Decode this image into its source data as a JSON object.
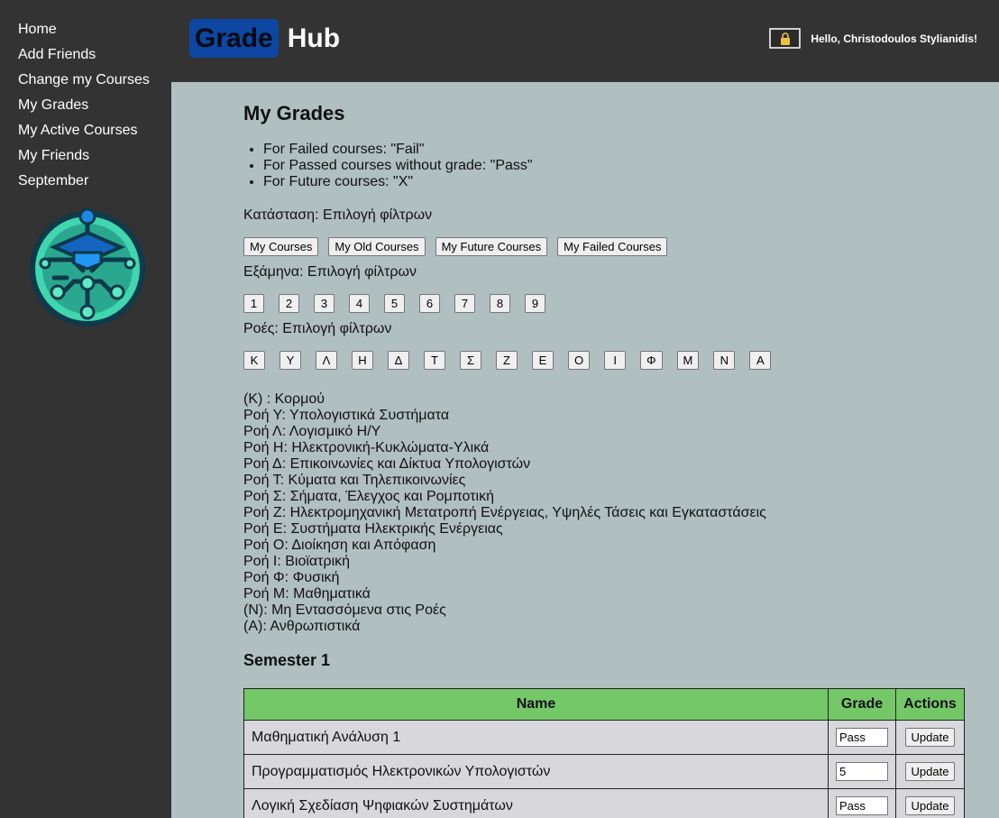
{
  "sidebar": {
    "items": [
      {
        "label": "Home"
      },
      {
        "label": "Add Friends"
      },
      {
        "label": "Change my Courses"
      },
      {
        "label": "My Grades"
      },
      {
        "label": "My Active Courses"
      },
      {
        "label": "My Friends"
      },
      {
        "label": "September"
      }
    ]
  },
  "header": {
    "brand_part1": "Grade",
    "brand_part2": "Hub",
    "greeting": "Hello, Christodoulos Stylianidis!"
  },
  "page": {
    "title": "My Grades",
    "hints": [
      "For Failed courses: \"Fail\"",
      "For Passed courses without grade: \"Pass\"",
      "For Future courses: \"X\""
    ]
  },
  "filters": {
    "status_label": "Κατάσταση: Επιλογή φίλτρων",
    "status_buttons": [
      "My Courses",
      "My Old Courses",
      "My Future Courses",
      "My Failed Courses"
    ],
    "semester_label": "Εξάμηνα: Επιλογή φίλτρων",
    "semester_buttons": [
      "1",
      "2",
      "3",
      "4",
      "5",
      "6",
      "7",
      "8",
      "9"
    ],
    "stream_label": "Ροές: Επιλογή φίλτρων",
    "stream_buttons": [
      "Κ",
      "Υ",
      "Λ",
      "Η",
      "Δ",
      "Τ",
      "Σ",
      "Ζ",
      "Ε",
      "Ο",
      "Ι",
      "Φ",
      "Μ",
      "Ν",
      "Α"
    ]
  },
  "legend": [
    "(Κ) : Κορμού",
    "Ροή Υ: Υπολογιστικά Συστήματα",
    "Ροή Λ: Λογισμικό Η/Υ",
    "Ροή Η: Ηλεκτρονική-Κυκλώματα-Υλικά",
    "Ροή Δ: Επικοινωνίες και Δίκτυα Υπολογιστών",
    "Ροή Τ: Κύματα και Τηλεπικοινωνίες",
    "Ροή Σ: Σήματα, Έλεγχος και Ρομποτική",
    "Ροή Ζ: Ηλεκτρομηχανική Μετατροπή Ενέργειας, Υψηλές Τάσεις και Εγκαταστάσεις",
    "Ροή Ε: Συστήματα Ηλεκτρικής Ενέργειας",
    "Ροή Ο: Διοίκηση και Απόφαση",
    "Ροή Ι: Βιοϊατρική",
    "Ροή Φ: Φυσική",
    "Ροή Μ: Μαθηματικά",
    "(Ν): Μη Εντασσόμενα στις Ροές",
    "(Α): Ανθρωπιστικά"
  ],
  "semester": {
    "title": "Semester 1",
    "columns": [
      "Name",
      "Grade",
      "Actions"
    ],
    "rows": [
      {
        "name": "Μαθηματική Ανάλυση 1",
        "grade": "Pass",
        "action": "Update"
      },
      {
        "name": "Προγραμματισμός Ηλεκτρονικών Υπολογιστών",
        "grade": "5",
        "action": "Update"
      },
      {
        "name": "Λογική Σχεδίαση Ψηφιακών Συστημάτων",
        "grade": "Pass",
        "action": "Update"
      }
    ]
  },
  "colors": {
    "sidebar_bg": "#333333",
    "page_bg": "#b0c0c0",
    "brand_blue": "#0d47a1",
    "table_header": "#74c868",
    "table_row": "#d8d8dc"
  },
  "icons": {
    "lock": "lock-icon",
    "logo": "graduation-cap-circuit-logo"
  }
}
